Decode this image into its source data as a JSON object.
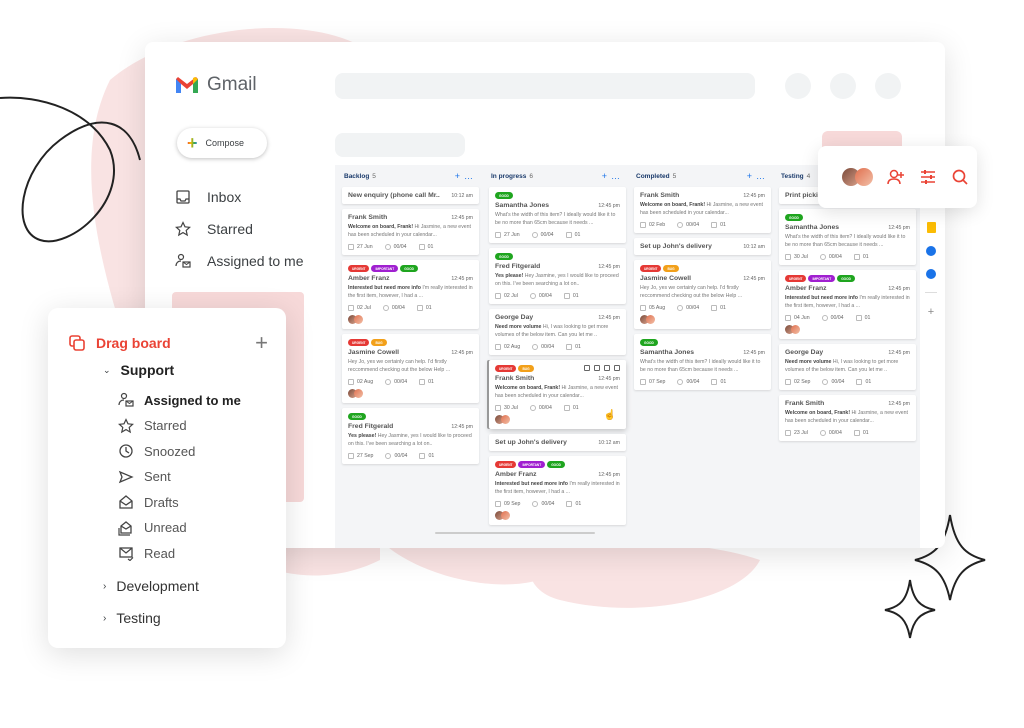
{
  "app": {
    "name": "Gmail",
    "compose_label": "Compose"
  },
  "colors": {
    "accent_red": "#ea4335",
    "blue": "#1a73e8",
    "tag_urgent": "#e53935",
    "tag_important": "#a020d0",
    "tag_good": "#1fa51f",
    "tag_bug": "#f2a01a"
  },
  "nav": [
    {
      "icon": "inbox-icon",
      "label": "Inbox"
    },
    {
      "icon": "star-icon",
      "label": "Starred"
    },
    {
      "icon": "assigned-icon",
      "label": "Assigned to me"
    }
  ],
  "board": {
    "columns": [
      {
        "title": "Backlog",
        "count": "5",
        "cards": [
          {
            "title": "New enquiry (phone call Mr..",
            "time": "10:12 am",
            "simple": true
          },
          {
            "title": "Frank Smith",
            "time": "12:45 pm",
            "lead": "Welcome on board, Frank!",
            "text": " Hi Jasmine, a new event has been scheduled in your calendar...",
            "date": "27 Jun",
            "checks": "00/04",
            "files": "01"
          },
          {
            "tags": [
              "urgent",
              "important",
              "good"
            ],
            "title": "Amber Franz",
            "time": "12:45 pm",
            "lead": "Interested but need more info",
            "text": " I'm really interested in the first item, however, I had a ...",
            "date": "02 Jul",
            "checks": "00/04",
            "files": "01",
            "avatars": true
          },
          {
            "tags": [
              "urgent",
              "bug"
            ],
            "title": "Jasmine Cowell",
            "time": "12:45 pm",
            "lead": "",
            "text": "Hey Jo, yes we certainly can help. I'd firstly reccommend checking out the below Help ...",
            "date": "02 Aug",
            "checks": "00/04",
            "files": "01",
            "avatars": true
          },
          {
            "tags": [
              "good"
            ],
            "title": "Fred Fitgerald",
            "time": "12:45 pm",
            "lead": "Yes please!",
            "text": " Hey Jasmine, yes I would like to proceed on this. I've been searching a lot on..",
            "date": "27 Sep",
            "checks": "00/04",
            "files": "01"
          }
        ]
      },
      {
        "title": "In progress",
        "count": "6",
        "cards": [
          {
            "tags": [
              "good"
            ],
            "title": "Samantha Jones",
            "time": "12:45 pm",
            "lead": "",
            "text": "What's the width of this item? I ideally would like it to be no more than 65cm because it needs ...",
            "date": "27 Jun",
            "checks": "00/04",
            "files": "01"
          },
          {
            "tags": [
              "good"
            ],
            "title": "Fred Fitgerald",
            "time": "12:45 pm",
            "lead": "Yes please!",
            "text": " Hey Jasmine, yes I would like to proceed on this. I've been searching a lot on..",
            "date": "02 Jul",
            "checks": "00/04",
            "files": "01"
          },
          {
            "title": "George Day",
            "time": "12:45 pm",
            "lead": "Need more volume",
            "text": " Hi, I was looking to get more volumes of the below item. Can you let me ..",
            "date": "02 Aug",
            "checks": "00/04",
            "files": "01"
          },
          {
            "tags": [
              "urgent",
              "bug"
            ],
            "title": "Frank Smith",
            "time": "12:45 pm",
            "lead": "Welcome on board, Frank!",
            "text": " Hi Jasmine, a new event has been scheduled in your calendar...",
            "date": "30 Jul",
            "checks": "00/04",
            "files": "01",
            "avatars": true,
            "hovered": true
          },
          {
            "title": "Set up John's delivery",
            "time": "10:12 am",
            "simple": true
          },
          {
            "tags": [
              "urgent",
              "important",
              "good"
            ],
            "title": "Amber Franz",
            "time": "12:45 pm",
            "lead": "Interested but need more info",
            "text": " I'm really interested in the first item, however, I had a ...",
            "date": "09 Sep",
            "checks": "00/04",
            "files": "01",
            "avatars": true
          }
        ]
      },
      {
        "title": "Completed",
        "count": "5",
        "cards": [
          {
            "title": "Frank Smith",
            "time": "12:45 pm",
            "lead": "Welcome on board, Frank!",
            "text": " Hi Jasmine, a new event has been scheduled in your calendar...",
            "date": "02 Feb",
            "checks": "00/04",
            "files": "01"
          },
          {
            "title": "Set up John's delivery",
            "time": "10:12 am",
            "simple": true
          },
          {
            "tags": [
              "urgent",
              "bug"
            ],
            "title": "Jasmine Cowell",
            "time": "12:45 pm",
            "lead": "",
            "text": "Hey Jo, yes we certainly can help. I'd firstly reccommend checking out the below Help ...",
            "date": "05 Aug",
            "checks": "00/04",
            "files": "01",
            "avatars": true
          },
          {
            "tags": [
              "good"
            ],
            "title": "Samantha Jones",
            "time": "12:45 pm",
            "lead": "",
            "text": "What's the width of this item? I ideally would like it to be no more than 65cm because it needs ...",
            "date": "07 Sep",
            "checks": "00/04",
            "files": "01"
          }
        ]
      },
      {
        "title": "Testing",
        "count": "4",
        "cards": [
          {
            "title": "Print picking",
            "time": "",
            "simple": true
          },
          {
            "tags": [
              "good"
            ],
            "title": "Samantha Jones",
            "time": "12:45 pm",
            "lead": "",
            "text": "What's the width of this item? I ideally would like it to be no more than 65cm because it needs ...",
            "date": "30 Jul",
            "checks": "00/04",
            "files": "01"
          },
          {
            "tags": [
              "urgent",
              "important",
              "good"
            ],
            "title": "Amber Franz",
            "time": "12:45 pm",
            "lead": "Interested but need more info",
            "text": " I'm really interested in the first item, however, I had a ...",
            "date": "04 Jun",
            "checks": "00/04",
            "files": "01",
            "avatars": true
          },
          {
            "title": "George Day",
            "time": "12:45 pm",
            "lead": "Need more volume",
            "text": " Hi, I was looking to get more volumes of the below item. Can you let me ..",
            "date": "02 Sep",
            "checks": "00/04",
            "files": "01"
          },
          {
            "title": "Frank Smith",
            "time": "12:45 pm",
            "lead": "Welcome on board, Frank!",
            "text": " Hi Jasmine, a new event has been scheduled in your calendar...",
            "date": "23 Jul",
            "checks": "00/04",
            "files": "01"
          }
        ]
      }
    ]
  },
  "tag_labels": {
    "urgent": "Urgent",
    "important": "Important",
    "good": "Good",
    "bug": "Bug"
  },
  "panel": {
    "title": "Drag board",
    "groups": [
      {
        "label": "Support",
        "expanded": true
      },
      {
        "label": "Development",
        "expanded": false
      },
      {
        "label": "Testing",
        "expanded": false
      }
    ],
    "items": [
      {
        "icon": "assigned-icon",
        "label": "Assigned to me",
        "active": true
      },
      {
        "icon": "star-icon",
        "label": "Starred"
      },
      {
        "icon": "clock-icon",
        "label": "Snoozed"
      },
      {
        "icon": "send-icon",
        "label": "Sent"
      },
      {
        "icon": "drafts-icon",
        "label": "Drafts"
      },
      {
        "icon": "unread-icon",
        "label": "Unread"
      },
      {
        "icon": "read-icon",
        "label": "Read"
      }
    ]
  }
}
